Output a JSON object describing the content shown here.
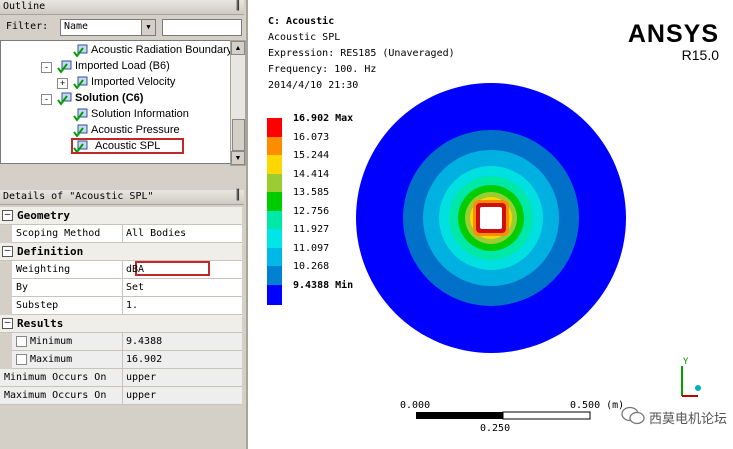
{
  "outline": {
    "title": "Outline",
    "filter_label": "Filter:",
    "filter_value": "Name",
    "filter_input": "",
    "tree": [
      {
        "label": "Acoustic Radiation Boundary",
        "indent": 1,
        "bold": false,
        "icon": "boundary-icon"
      },
      {
        "label": "Imported Load (B6)",
        "indent": 0,
        "bold": false,
        "icon": "folder-icon",
        "expander": "-"
      },
      {
        "label": "Imported Velocity",
        "indent": 1,
        "bold": false,
        "icon": "velocity-icon",
        "expander": "+"
      },
      {
        "label": "Solution (C6)",
        "indent": 0,
        "bold": true,
        "icon": "solution-icon",
        "expander": "-"
      },
      {
        "label": "Solution Information",
        "indent": 1,
        "bold": false,
        "icon": "info-icon"
      },
      {
        "label": "Acoustic Pressure",
        "indent": 1,
        "bold": false,
        "icon": "pressure-icon"
      },
      {
        "label": "Acoustic SPL",
        "indent": 1,
        "bold": false,
        "icon": "spl-icon",
        "selected": true
      }
    ]
  },
  "details": {
    "title": "Details of \"Acoustic SPL\"",
    "groups": {
      "geometry": "Geometry",
      "definition": "Definition",
      "results": "Results"
    },
    "rows": {
      "scoping_method": {
        "key": "Scoping Method",
        "value": "All Bodies"
      },
      "weighting": {
        "key": "Weighting",
        "value": "dBA"
      },
      "by": {
        "key": "By",
        "value": "Set"
      },
      "substep": {
        "key": "Substep",
        "value": "1."
      },
      "minimum": {
        "key": "Minimum",
        "value": "9.4388"
      },
      "maximum": {
        "key": "Maximum",
        "value": "16.902"
      },
      "min_occurs": {
        "key": "Minimum Occurs On",
        "value": "upper"
      },
      "max_occurs": {
        "key": "Maximum Occurs On",
        "value": "upper"
      }
    }
  },
  "viewport": {
    "title": "C: Acoustic",
    "subtitle": "Acoustic SPL",
    "expression": "Expression: RES185 (Unaveraged)",
    "frequency": "Frequency: 100. Hz",
    "timestamp": "2014/4/10 21:30",
    "logo_brand": "ANSYS",
    "logo_version": "R15.0",
    "legend": [
      {
        "label": "16.902 Max",
        "color": "#ff0000"
      },
      {
        "label": "16.073",
        "color": "#ff8c00"
      },
      {
        "label": "15.244",
        "color": "#ffd700"
      },
      {
        "label": "14.414",
        "color": "#9acd32"
      },
      {
        "label": "13.585",
        "color": "#00cc00"
      },
      {
        "label": "12.756",
        "color": "#00e8a8"
      },
      {
        "label": "11.927",
        "color": "#00e5e5"
      },
      {
        "label": "11.097",
        "color": "#00b8e8"
      },
      {
        "label": "10.268",
        "color": "#0080d0"
      },
      {
        "label": "9.4388 Min",
        "color": "#0000ff"
      }
    ],
    "scale_labels": {
      "left": "0.000",
      "right": "0.500 (m)",
      "mid": "0.250"
    },
    "axis_label": "Y",
    "watermark": "西莫电机论坛"
  }
}
